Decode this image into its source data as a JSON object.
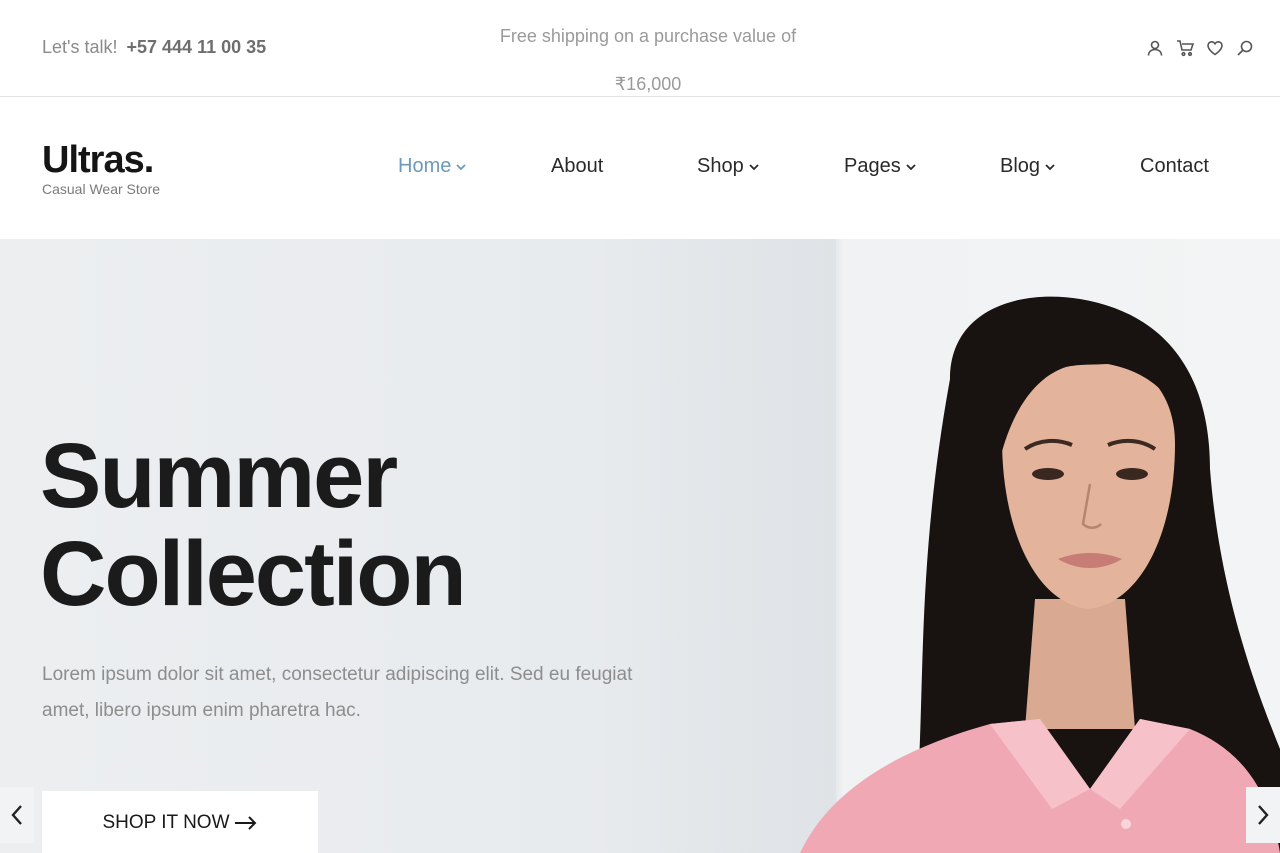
{
  "topbar": {
    "talk_label": "Let's talk!",
    "phone": "+57 444 11 00 35",
    "shipping_line1": "Free shipping on a purchase value of",
    "shipping_line2": "₹16,000",
    "icons": [
      "user-icon",
      "cart-icon",
      "heart-icon",
      "search-icon"
    ]
  },
  "header": {
    "logo_name": "Ultras.",
    "logo_tagline": "Casual Wear Store",
    "nav": [
      {
        "label": "Home",
        "dropdown": true,
        "active": true
      },
      {
        "label": "About",
        "dropdown": false,
        "active": false
      },
      {
        "label": "Shop",
        "dropdown": true,
        "active": false
      },
      {
        "label": "Pages",
        "dropdown": true,
        "active": false
      },
      {
        "label": "Blog",
        "dropdown": true,
        "active": false
      },
      {
        "label": "Contact",
        "dropdown": false,
        "active": false
      }
    ]
  },
  "hero": {
    "title_line1": "Summer",
    "title_line2": "Collection",
    "description": "Lorem ipsum dolor sit amet, consectetur adipiscing elit. Sed eu feugiat amet, libero ipsum enim pharetra hac.",
    "cta_label": "SHOP IT NOW"
  },
  "colors": {
    "accent_active_nav": "#6d9ab8",
    "text_dark": "#1b1b1b",
    "text_muted": "#8d8d8d"
  }
}
